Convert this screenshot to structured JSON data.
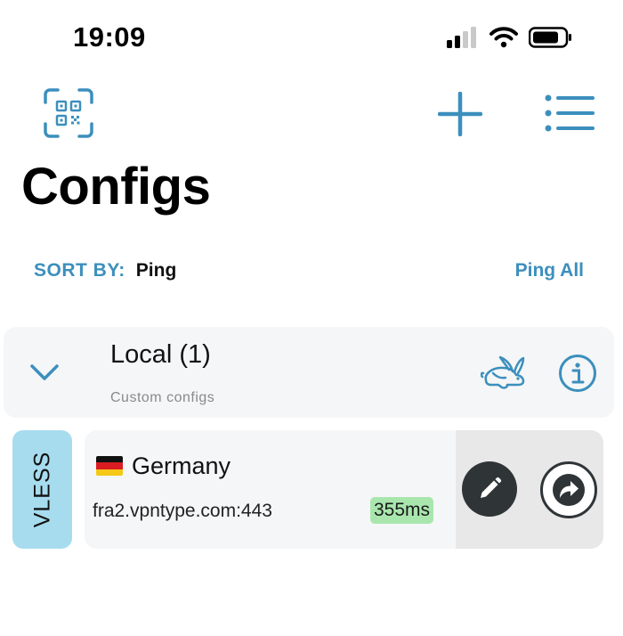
{
  "status_bar": {
    "time": "19:09",
    "icons": [
      "signal-icon",
      "wifi-icon",
      "battery-icon"
    ]
  },
  "toolbar": {
    "icons": [
      "qr-code-scan-icon",
      "plus-icon",
      "list-icon"
    ]
  },
  "page": {
    "title": "Configs"
  },
  "sort": {
    "label": "SORT BY:",
    "value": "Ping",
    "ping_all_label": "Ping All"
  },
  "group": {
    "title": "Local (1)",
    "subtitle": "Custom configs",
    "icons": [
      "chevron-down-icon",
      "rabbit-icon",
      "info-icon"
    ]
  },
  "configs": [
    {
      "protocol": "VLESS",
      "flag": "germany-flag-icon",
      "name": "Germany",
      "host": "fra2.vpntype.com:443",
      "ping": "355ms",
      "actions": [
        "pencil-icon",
        "share-icon"
      ]
    }
  ],
  "colors": {
    "accent": "#3c8fbd",
    "protocol_tag": "#a7dcee",
    "ping_badge": "#a9e6ae",
    "card_background": "#f4f6f7",
    "action_dark": "#2f3437"
  }
}
